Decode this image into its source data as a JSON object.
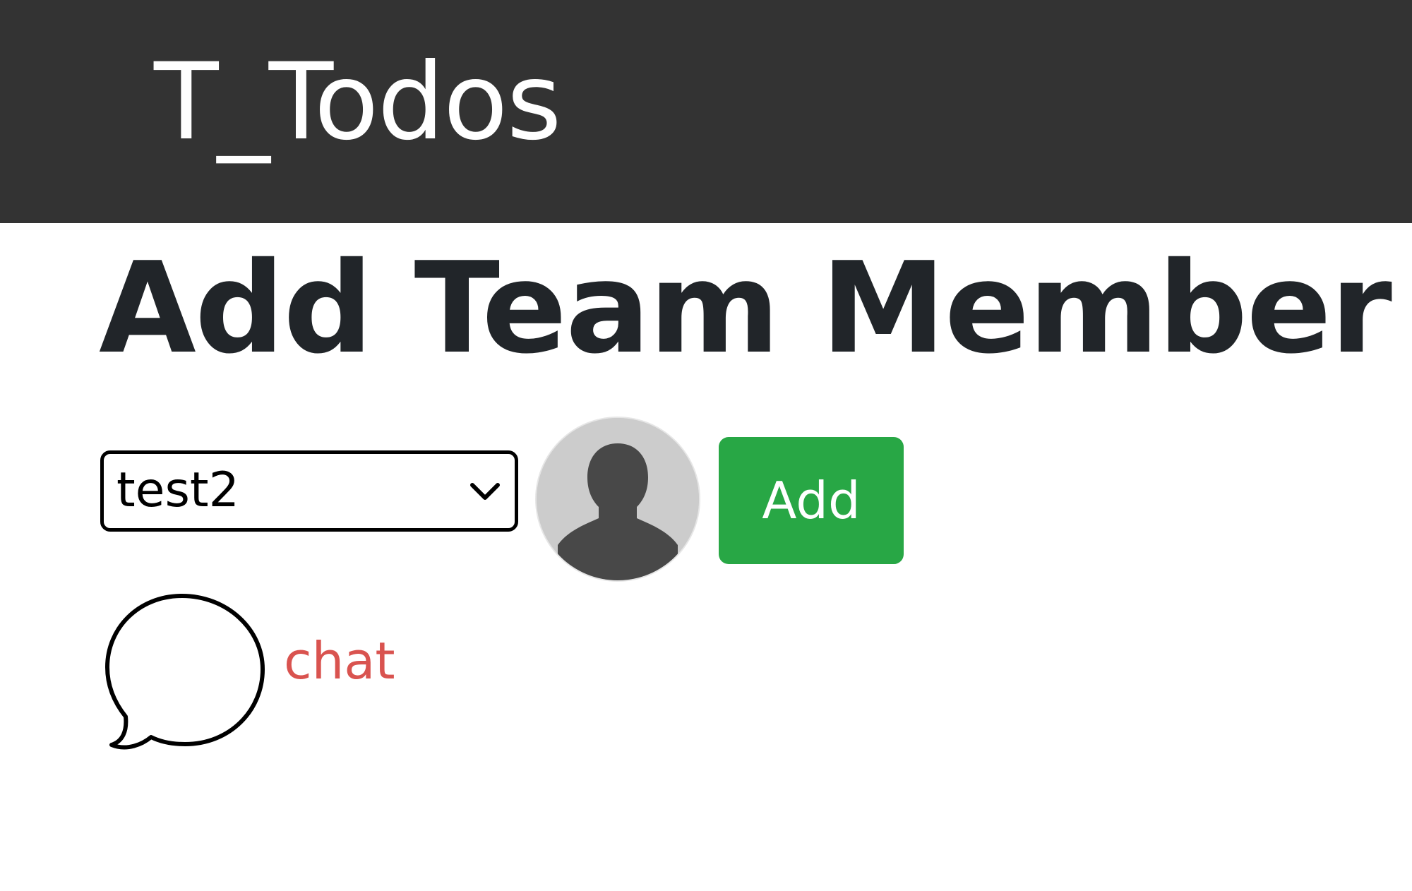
{
  "navbar": {
    "brand": "T_Todos",
    "background": "#333333"
  },
  "page": {
    "title": "Add Team Member"
  },
  "member_select": {
    "selected": "test2"
  },
  "avatar": {
    "icon": "user-silhouette-icon"
  },
  "add_button": {
    "label": "Add",
    "color": "#28a745"
  },
  "chat": {
    "label": "chat",
    "icon": "chat-bubble-icon",
    "color": "#d9534f"
  }
}
